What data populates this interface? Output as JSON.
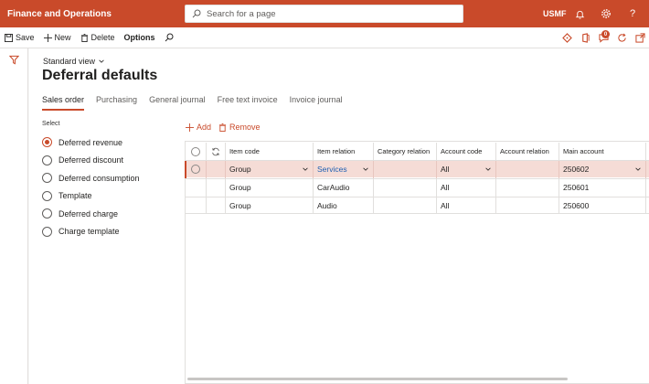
{
  "app": {
    "title": "Finance and Operations",
    "search_placeholder": "Search for a page",
    "company": "USMF",
    "help_label": "?"
  },
  "toolbar": {
    "save": "Save",
    "new": "New",
    "delete": "Delete",
    "options": "Options",
    "notification_count": "0"
  },
  "page": {
    "view": "Standard view",
    "title": "Deferral defaults"
  },
  "tabs": [
    {
      "label": "Sales order",
      "active": true
    },
    {
      "label": "Purchasing",
      "active": false
    },
    {
      "label": "General journal",
      "active": false
    },
    {
      "label": "Free text invoice",
      "active": false
    },
    {
      "label": "Invoice journal",
      "active": false
    }
  ],
  "select": {
    "label": "Select",
    "options": [
      {
        "label": "Deferred revenue",
        "checked": true
      },
      {
        "label": "Deferred discount",
        "checked": false
      },
      {
        "label": "Deferred consumption",
        "checked": false
      },
      {
        "label": "Template",
        "checked": false
      },
      {
        "label": "Deferred charge",
        "checked": false
      },
      {
        "label": "Charge template",
        "checked": false
      }
    ]
  },
  "grid_actions": {
    "add": "Add",
    "remove": "Remove"
  },
  "grid": {
    "columns": {
      "item_code": "Item code",
      "item_relation": "Item relation",
      "category_relation": "Category relation",
      "account_code": "Account code",
      "account_relation": "Account relation",
      "main_account": "Main account"
    },
    "rows": [
      {
        "item_code": "Group",
        "item_relation": "Services",
        "category_relation": "",
        "account_code": "All",
        "account_relation": "",
        "main_account": "250602"
      },
      {
        "item_code": "Group",
        "item_relation": "CarAudio",
        "category_relation": "",
        "account_code": "All",
        "account_relation": "",
        "main_account": "250601"
      },
      {
        "item_code": "Group",
        "item_relation": "Audio",
        "category_relation": "",
        "account_code": "All",
        "account_relation": "",
        "main_account": "250600"
      }
    ]
  }
}
